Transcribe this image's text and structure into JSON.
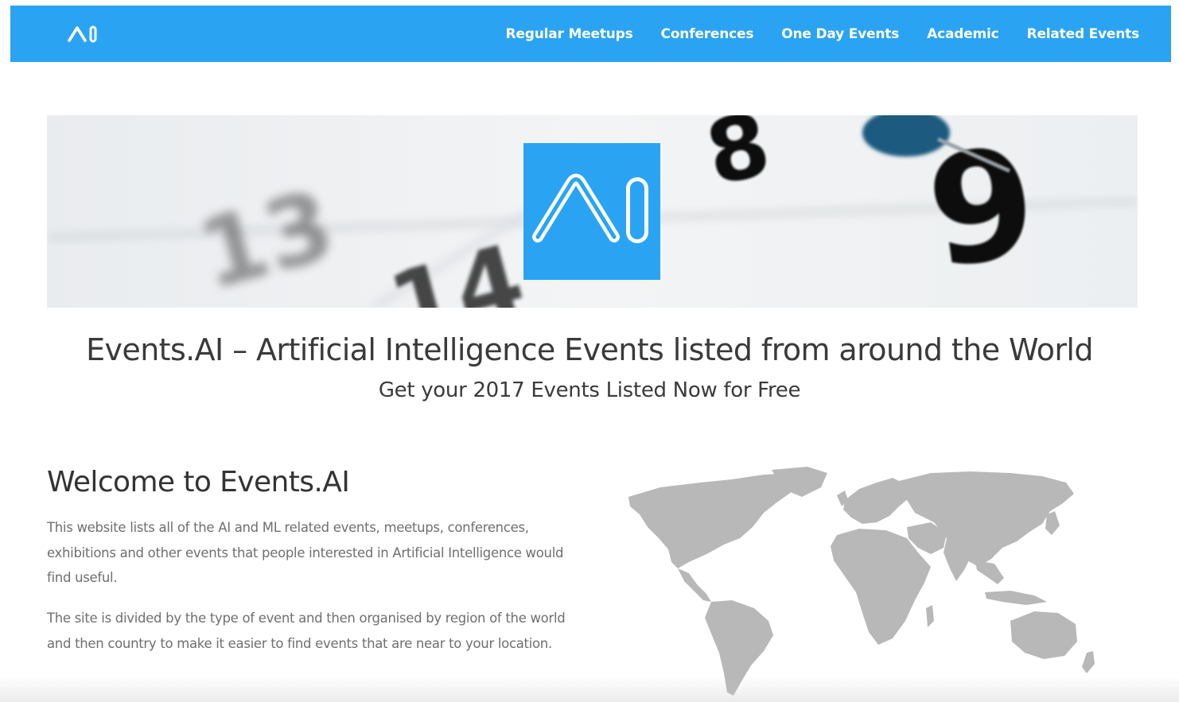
{
  "brand": {
    "logo_text": "AI",
    "accent_color": "#2aa4f2"
  },
  "nav": {
    "items": [
      {
        "label": "Regular Meetups"
      },
      {
        "label": "Conferences"
      },
      {
        "label": "One Day Events"
      },
      {
        "label": "Academic"
      },
      {
        "label": "Related Events"
      }
    ]
  },
  "hero": {
    "calendar_numbers": [
      "13",
      "14",
      "8",
      "9"
    ]
  },
  "headline": "Events.AI – Artificial Intelligence Events listed from around the World",
  "subheadline": "Get your 2017 Events Listed Now for Free",
  "welcome": {
    "title": "Welcome to Events.AI",
    "paragraphs": [
      "This website lists all of the AI and ML related events, meetups, conferences, exhibitions and other events that people interested in Artificial Intelligence would find useful.",
      "The site is divided by the type of event and then organised by region of the world and then country to make it easier to find events that are near to your location."
    ]
  },
  "map": {
    "icon": "world-map-icon",
    "land_color": "#b8b8b8"
  }
}
